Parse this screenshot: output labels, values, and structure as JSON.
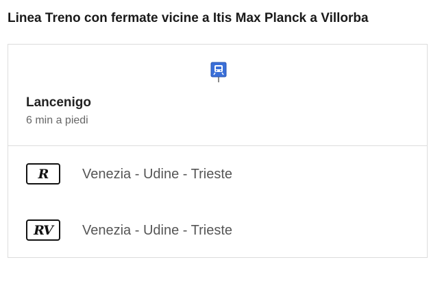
{
  "page": {
    "title": "Linea Treno con fermate vicine a Itis Max Planck a Villorba"
  },
  "stop": {
    "icon": "train-station-icon",
    "name": "Lancenigo",
    "distance": "6 min a piedi"
  },
  "lines": [
    {
      "badge": "R",
      "badge_icon": "regional-train-icon",
      "name": "Venezia - Udine - Trieste"
    },
    {
      "badge": "RV",
      "badge_icon": "regional-express-train-icon",
      "name": "Venezia - Udine - Trieste"
    }
  ],
  "colors": {
    "station_icon_blue": "#3a6fd8",
    "border": "#dcdcdc",
    "text_secondary": "#555555"
  }
}
